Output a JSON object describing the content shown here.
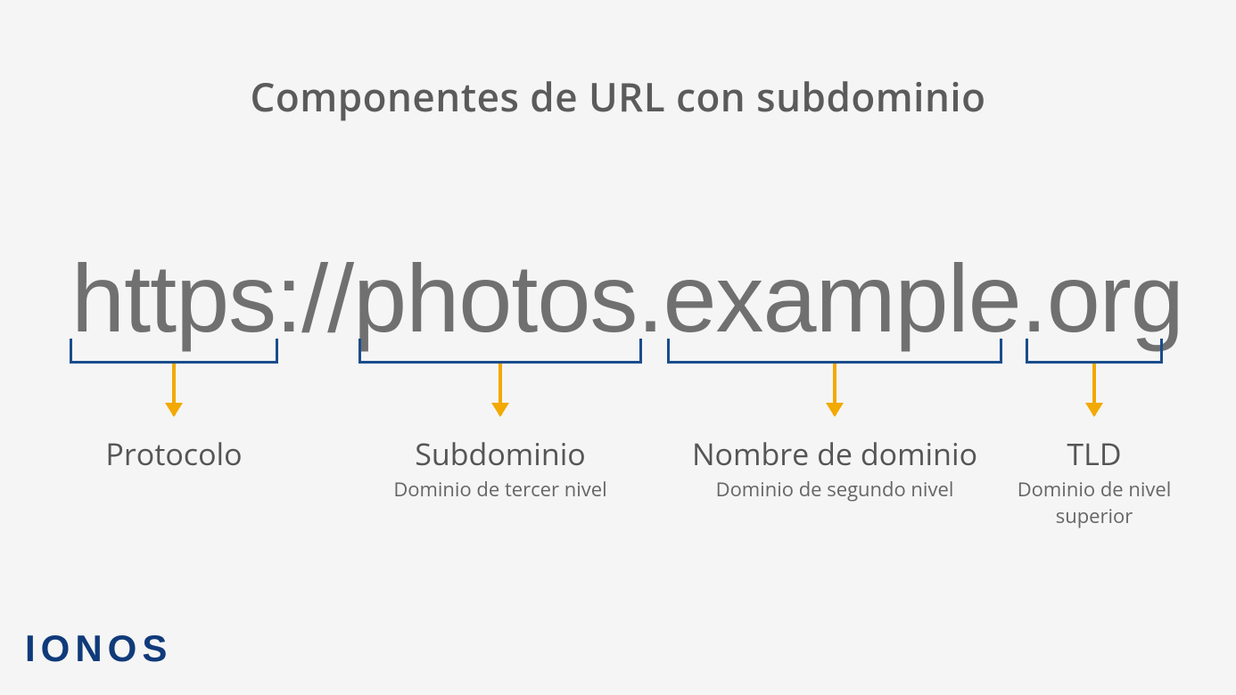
{
  "title": "Componentes de URL con subdominio",
  "url": {
    "protocol": "https://",
    "subdomain": "photos",
    "dot1": ".",
    "domain": "example",
    "dot2": ".",
    "tld": "org"
  },
  "parts": {
    "protocol": {
      "label": "Protocolo",
      "sub": ""
    },
    "subdomain": {
      "label": "Subdominio",
      "sub": "Dominio de tercer nivel"
    },
    "domain": {
      "label": "Nombre de dominio",
      "sub": "Dominio de segundo nivel"
    },
    "tld": {
      "label": "TLD",
      "sub": "Dominio de nivel superior"
    }
  },
  "logo": "IONOS"
}
